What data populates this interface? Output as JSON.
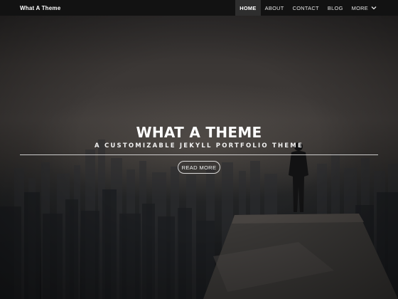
{
  "site": {
    "brand": "What A Theme"
  },
  "nav": {
    "items": [
      {
        "label": "HOME",
        "active": true
      },
      {
        "label": "ABOUT",
        "active": false
      },
      {
        "label": "CONTACT",
        "active": false
      },
      {
        "label": "BLOG",
        "active": false
      },
      {
        "label": "MORE",
        "active": false,
        "has_dropdown": true
      }
    ]
  },
  "hero": {
    "title": "WHAT A THEME",
    "subtitle": "A CUSTOMIZABLE JEKYLL PORTFOLIO THEME",
    "button_label": "READ MORE",
    "background_image": "foggy-city-skyline-with-person-on-rooftop"
  },
  "colors": {
    "navbar_bg": "#121212",
    "nav_active_bg": "#2e2e2e",
    "text": "#ffffff"
  }
}
